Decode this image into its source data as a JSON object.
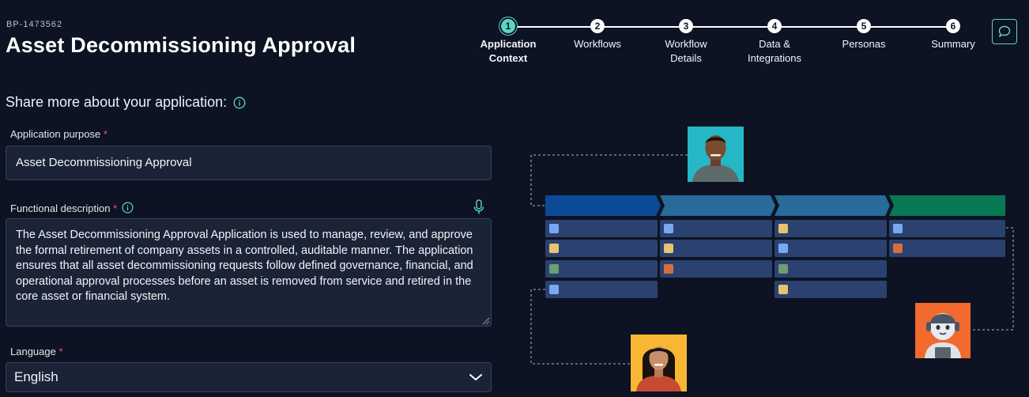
{
  "header": {
    "bp_id": "BP-1473562",
    "title": "Asset Decommissioning Approval"
  },
  "stepper": {
    "active_step": 1,
    "steps": [
      {
        "number": "1",
        "label_line1": "Application",
        "label_line2": "Context"
      },
      {
        "number": "2",
        "label_line1": "Workflows",
        "label_line2": ""
      },
      {
        "number": "3",
        "label_line1": "Workflow",
        "label_line2": "Details"
      },
      {
        "number": "4",
        "label_line1": "Data &",
        "label_line2": "Integrations"
      },
      {
        "number": "5",
        "label_line1": "Personas",
        "label_line2": ""
      },
      {
        "number": "6",
        "label_line1": "Summary",
        "label_line2": ""
      }
    ]
  },
  "chat_button": {
    "icon": "chat-bubble-icon"
  },
  "form": {
    "heading": "Share more about your application:",
    "purpose": {
      "label": "Application purpose",
      "required_mark": "*",
      "value": "Asset Decommissioning Approval"
    },
    "description": {
      "label": "Functional description",
      "required_mark": "*",
      "value": "The Asset Decommissioning Approval Application is used to manage, review, and approve the formal retirement of company assets in a controlled, auditable manner. The application ensures that all asset decommissioning requests follow defined governance, financial, and operational approval processes before an asset is removed from service and retired in the core asset or financial system."
    },
    "language": {
      "label": "Language",
      "required_mark": "*",
      "value": "English"
    }
  },
  "colors": {
    "accent": "#5fd3c4",
    "background": "#0d1322",
    "required": "#e46060",
    "board_header_1": "#0b4a96",
    "board_header_2": "#286a9a",
    "board_header_4": "#087855",
    "cell": "#2b4170",
    "chip_blue": "#78a8f0",
    "chip_yellow": "#e9c26f",
    "chip_green": "#6c9e72",
    "chip_orange": "#d3703f",
    "avatar_bg_teal": "#25b7c5",
    "avatar_bg_yellow": "#f7b733",
    "avatar_bg_orange": "#f26a2e"
  }
}
